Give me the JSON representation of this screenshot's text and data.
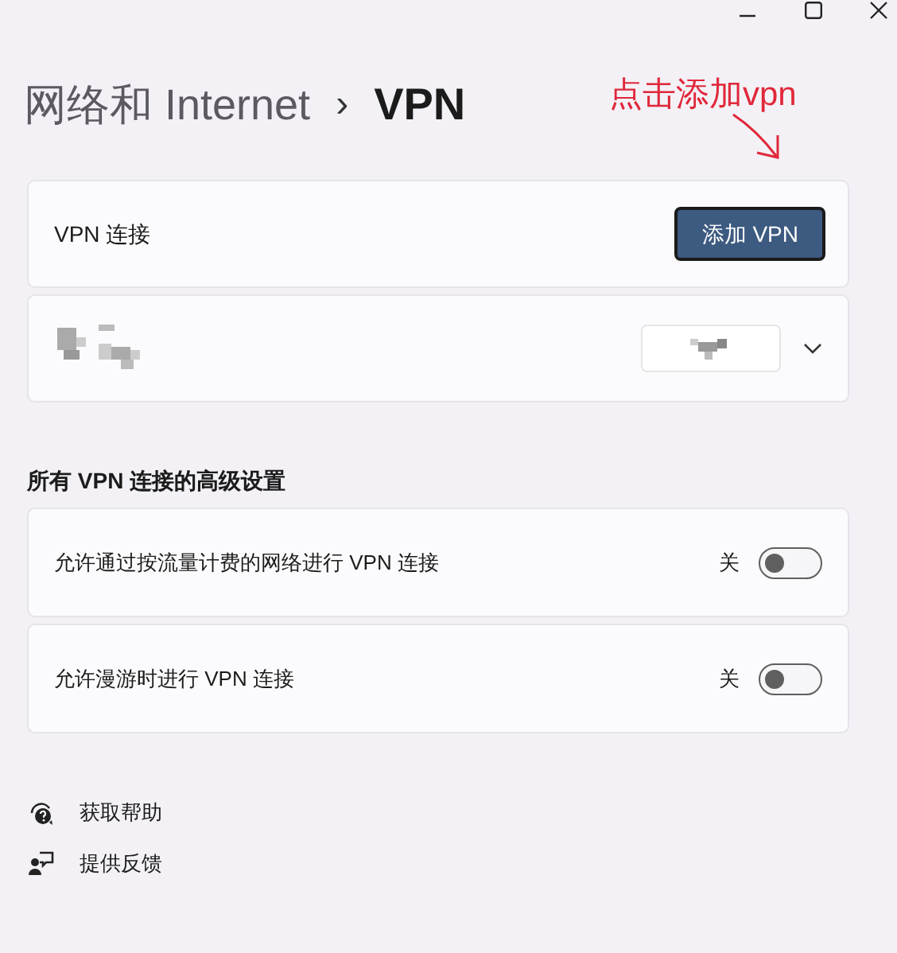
{
  "breadcrumb": {
    "parent": "网络和 Internet",
    "separator": "›",
    "current": "VPN"
  },
  "annotation": {
    "text": "点击添加vpn"
  },
  "vpn_card": {
    "label": "VPN 连接",
    "button": "添加 VPN"
  },
  "section_title": "所有 VPN 连接的高级设置",
  "settings": [
    {
      "label": "允许通过按流量计费的网络进行 VPN 连接",
      "state_text": "关",
      "on": false
    },
    {
      "label": "允许漫游时进行 VPN 连接",
      "state_text": "关",
      "on": false
    }
  ],
  "links": [
    {
      "kind": "help",
      "label": "获取帮助"
    },
    {
      "kind": "feedback",
      "label": "提供反馈"
    }
  ]
}
